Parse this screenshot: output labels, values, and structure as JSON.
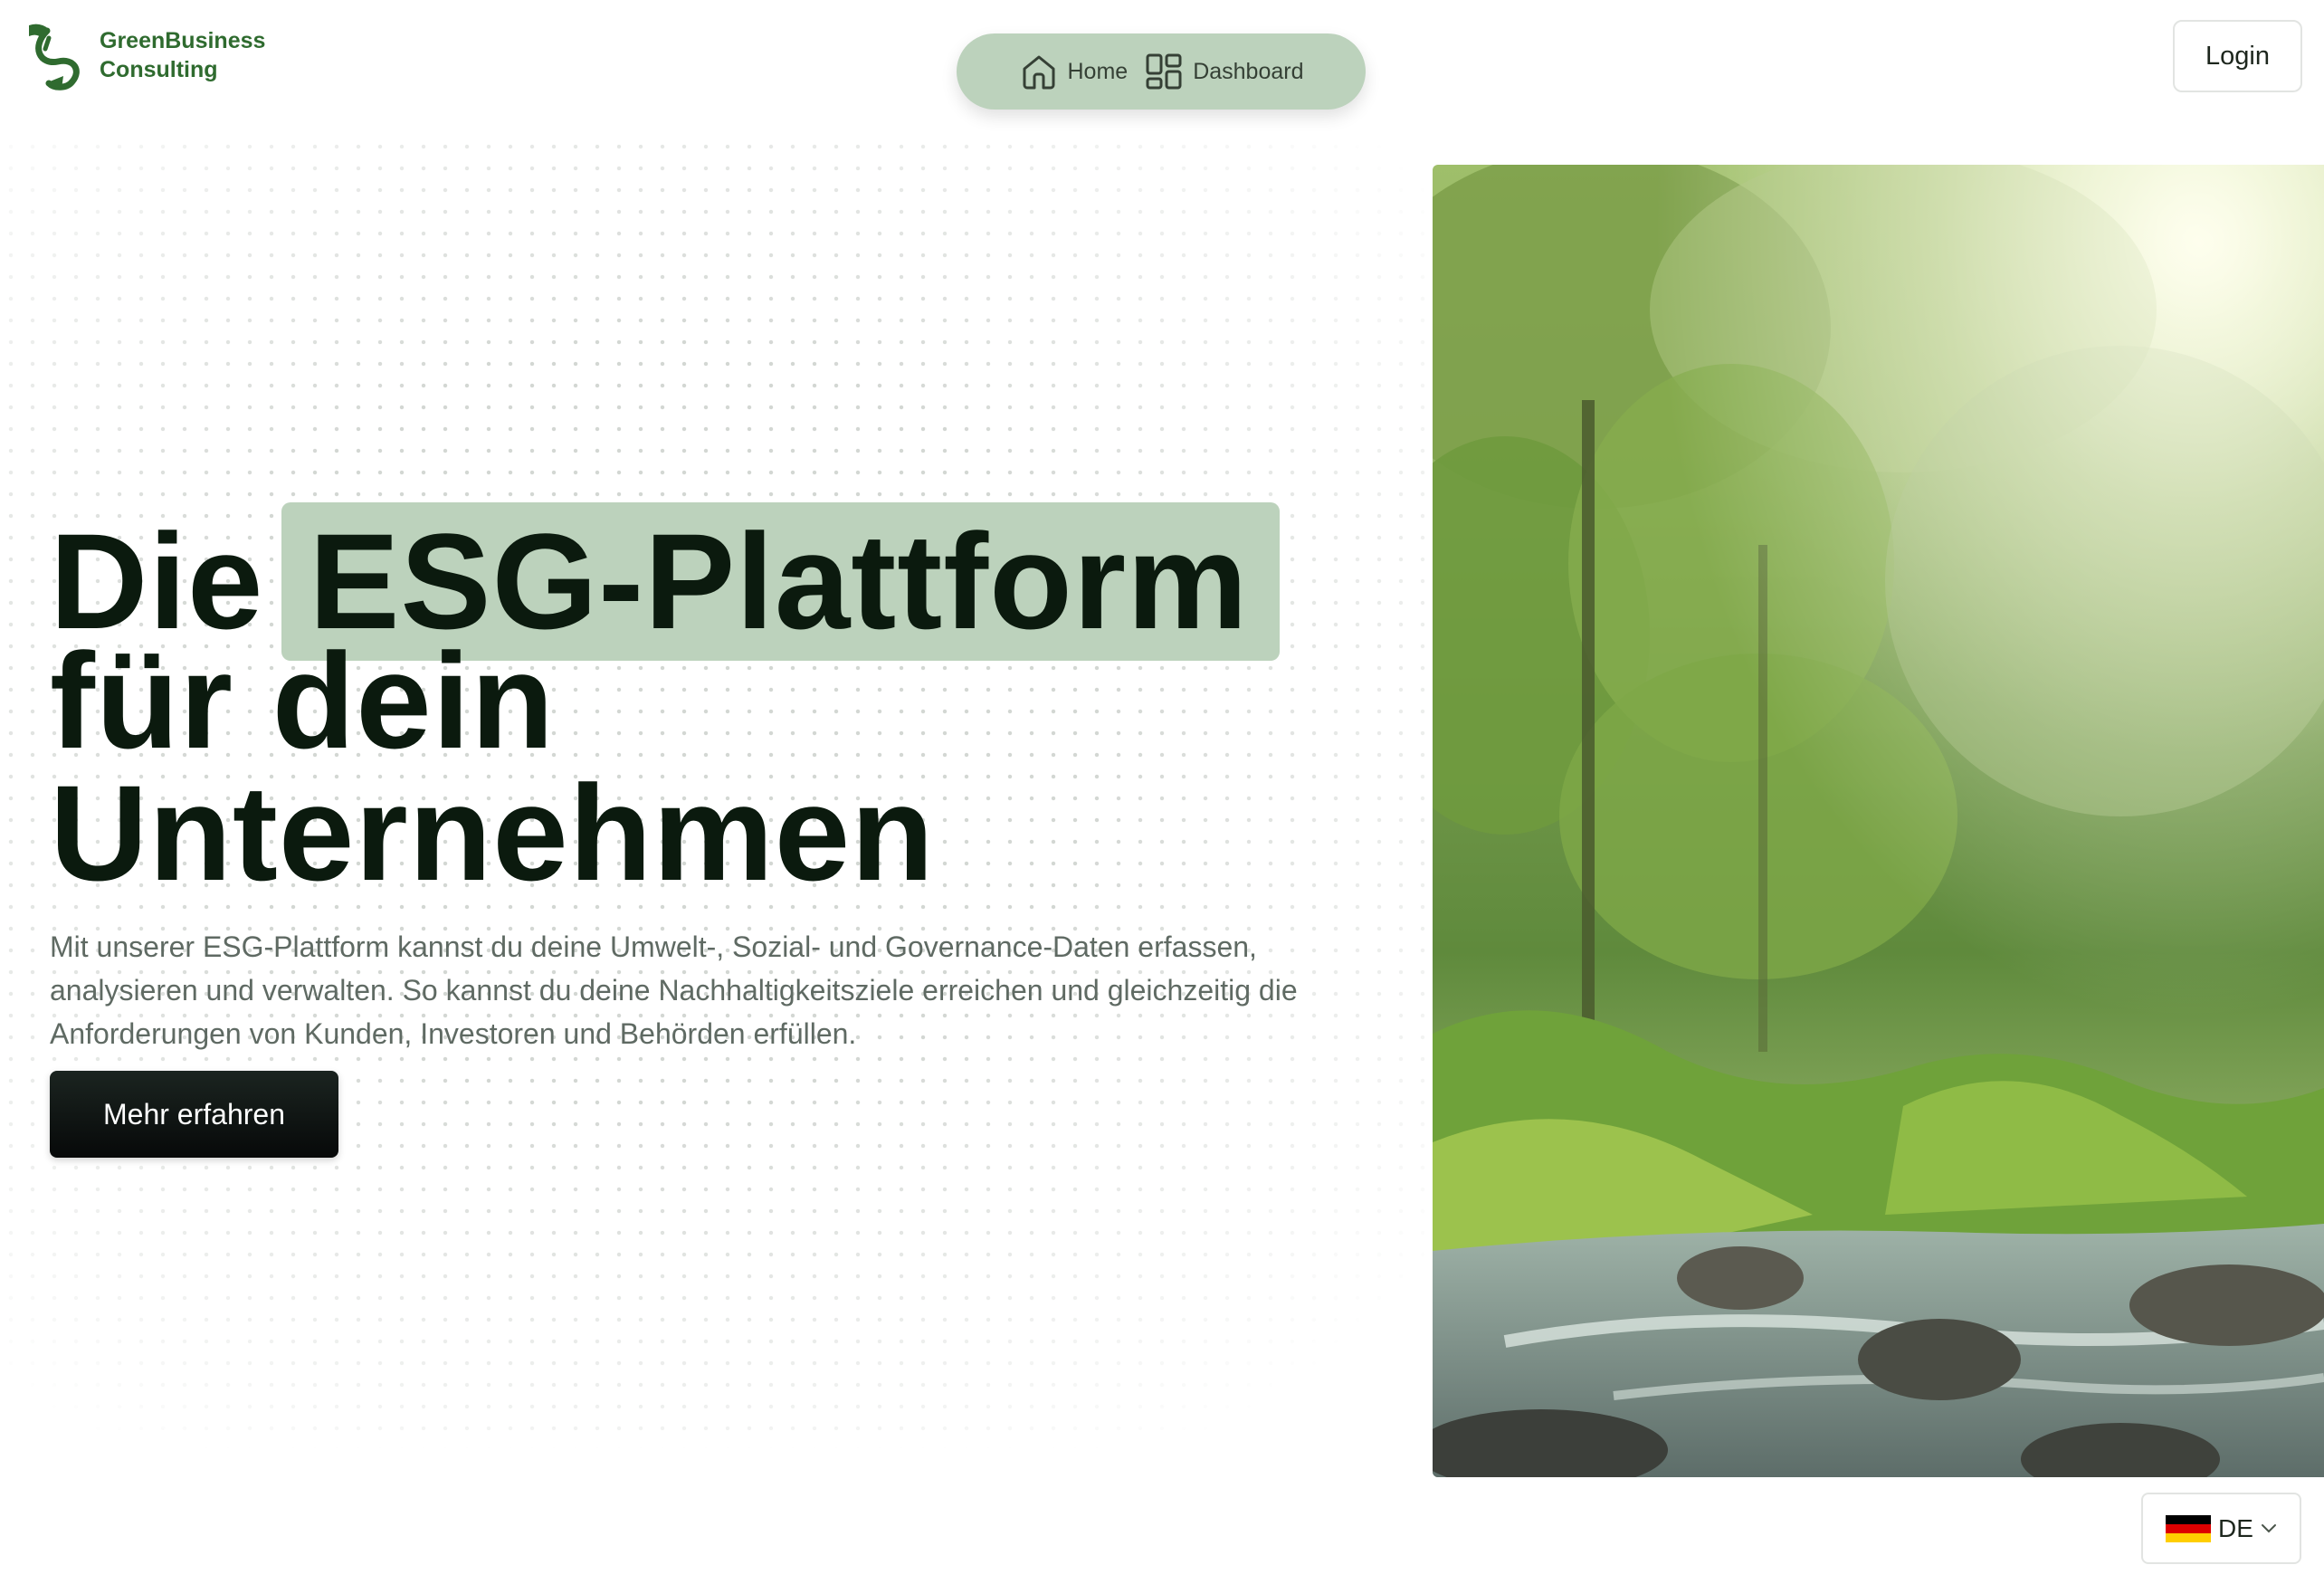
{
  "brand": {
    "line1": "GreenBusiness",
    "line2": "Consulting",
    "color": "#2f6b2f"
  },
  "nav": {
    "items": [
      {
        "label": "Home",
        "icon": "home-icon"
      },
      {
        "label": "Dashboard",
        "icon": "dashboard-grid-icon"
      }
    ]
  },
  "header": {
    "login_label": "Login"
  },
  "hero": {
    "title_part1": "Die",
    "title_highlight": "ESG-Plattform",
    "title_line2": "für dein",
    "title_line3": "Unternehmen",
    "description": "Mit unserer ESG-Plattform kannst du deine Umwelt-, Sozial- und Governance-Daten erfassen, analysieren und verwalten. So kannst du deine Nachhaltigkeitsziele erreichen und gleichzeitig die Anforderungen von Kunden, Investoren und Behörden erfüllen.",
    "cta_label": "Mehr erfahren",
    "highlight_color": "#bcd2bc"
  },
  "language": {
    "selected": "DE",
    "flag": "germany-flag-icon"
  }
}
